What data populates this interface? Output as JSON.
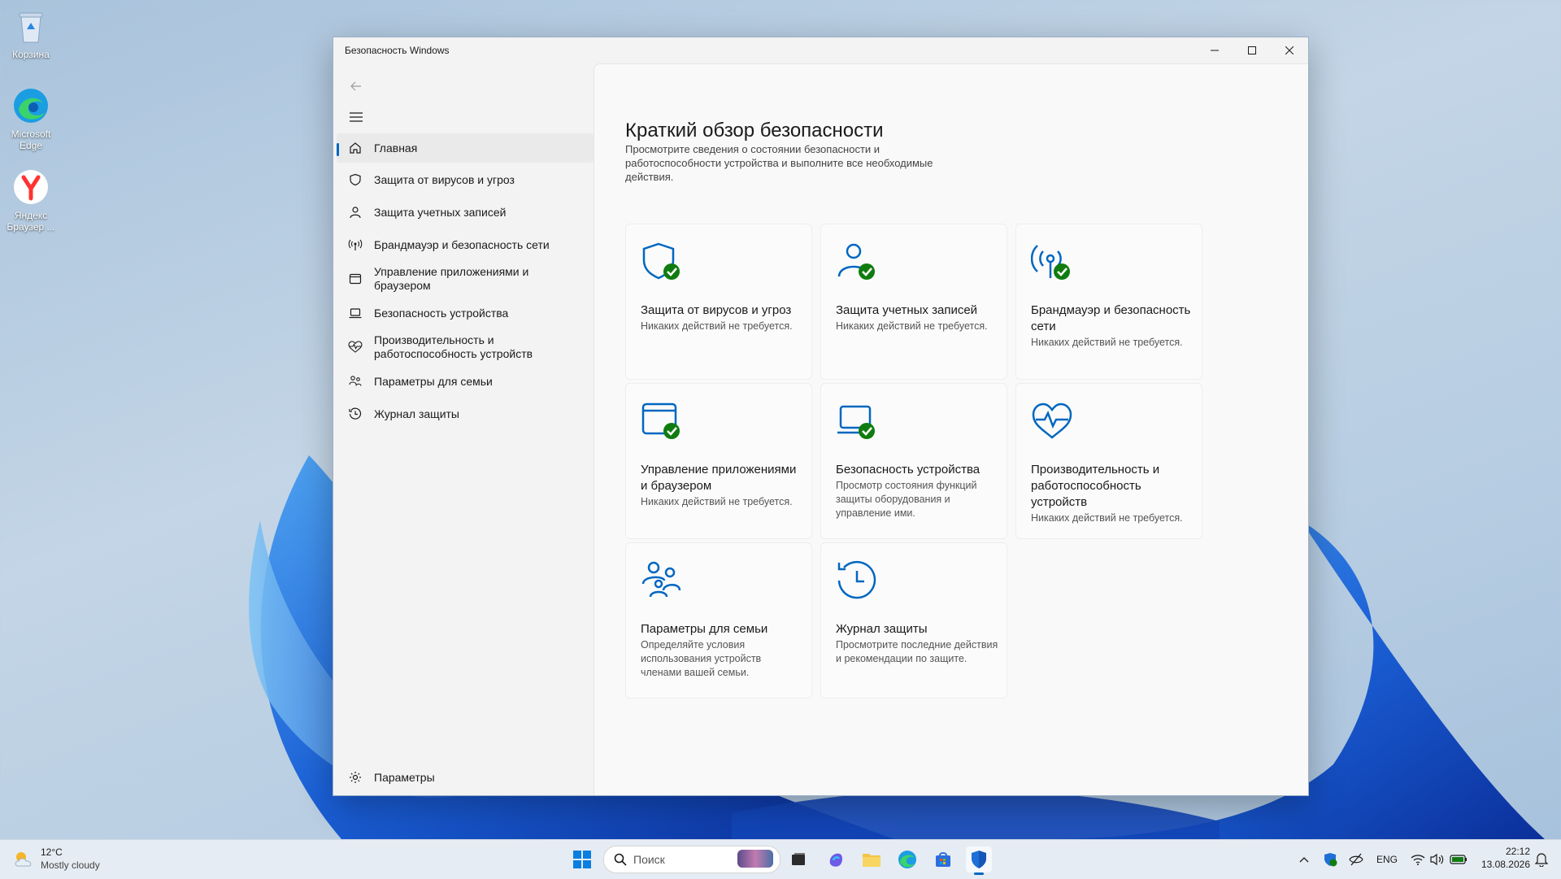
{
  "desktop": {
    "icons": [
      {
        "label": "Корзина"
      },
      {
        "label": "Microsoft Edge"
      },
      {
        "label": "Яндекс Браузер ..."
      }
    ]
  },
  "window": {
    "title": "Безопасность Windows"
  },
  "nav": {
    "items": [
      {
        "label": "Главная",
        "icon": "home-icon"
      },
      {
        "label": "Защита от вирусов и угроз",
        "icon": "shield-icon"
      },
      {
        "label": "Защита учетных записей",
        "icon": "person-icon"
      },
      {
        "label": "Брандмауэр и безопасность сети",
        "icon": "antenna-icon"
      },
      {
        "label": "Управление приложениями и браузером",
        "icon": "app-window-icon"
      },
      {
        "label": "Безопасность устройства",
        "icon": "laptop-icon"
      },
      {
        "label": "Производительность и работоспособность устройств",
        "icon": "heart-pulse-icon"
      },
      {
        "label": "Параметры для семьи",
        "icon": "family-icon"
      },
      {
        "label": "Журнал защиты",
        "icon": "history-icon"
      }
    ],
    "settings": "Параметры"
  },
  "main": {
    "title": "Краткий обзор безопасности",
    "description": "Просмотрите сведения о состоянии безопасности и работоспособности устройства и выполните все необходимые действия."
  },
  "cards": [
    {
      "title": "Защита от вирусов и угроз",
      "desc": "Никаких действий не требуется.",
      "icon": "shield-check-icon"
    },
    {
      "title": "Защита учетных записей",
      "desc": "Никаких действий не требуется.",
      "icon": "person-check-icon"
    },
    {
      "title": "Брандмауэр и безопасность сети",
      "desc": "Никаких действий не требуется.",
      "icon": "antenna-check-icon"
    },
    {
      "title": "Управление приложениями и браузером",
      "desc": "Никаких действий не требуется.",
      "icon": "app-window-check-icon"
    },
    {
      "title": "Безопасность устройства",
      "desc": "Просмотр состояния функций защиты оборудования и управление ими.",
      "icon": "laptop-check-icon"
    },
    {
      "title": "Производительность и работоспособность устройств",
      "desc": "Никаких действий не требуется.",
      "icon": "heart-pulse-icon"
    },
    {
      "title": "Параметры для семьи",
      "desc": "Определяйте условия использования устройств членами вашей семьи.",
      "icon": "family-icon"
    },
    {
      "title": "Журнал защиты",
      "desc": "Просмотрите последние действия и рекомендации по защите.",
      "icon": "history-icon"
    }
  ],
  "taskbar": {
    "weather_temp": "12°C",
    "weather_desc": "Mostly cloudy",
    "search_placeholder": "Поиск",
    "lang": "ENG",
    "time": "22:12",
    "date": "13.08.2026"
  },
  "colors": {
    "accent": "#0067c0",
    "ok_badge": "#107c10"
  }
}
